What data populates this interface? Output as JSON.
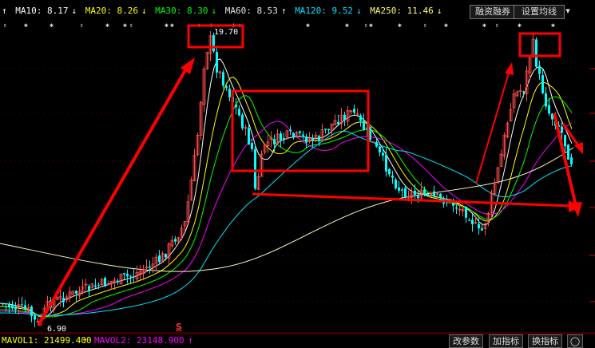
{
  "ma_legend": [
    {
      "label": "MA10: 8.17",
      "arrow": "↓",
      "color": "#ffffff",
      "arrow_color": "#ffffff"
    },
    {
      "label": "MA20: 8.26",
      "arrow": "↓",
      "color": "#ffff00",
      "arrow_color": "#ffff00"
    },
    {
      "label": "MA30: 8.30",
      "arrow": "↓",
      "color": "#00ff00",
      "arrow_color": "#00ff00"
    },
    {
      "label": "MA60: 8.53",
      "arrow": "↑",
      "color": "#e6e6e6",
      "arrow_color": "#e6e6e6"
    },
    {
      "label": "MA120: 9.52",
      "arrow": "↓",
      "color": "#00e5ff",
      "arrow_color": "#00e5ff"
    },
    {
      "label": "MA250: 11.46",
      "arrow": "↓",
      "color": "#ffff66",
      "arrow_color": "#ffff66"
    }
  ],
  "ma_prefix_arrow": "↑",
  "buttons": {
    "margin_trading": "融资融券",
    "set_ma": "设置均线",
    "dropdown": "▾"
  },
  "price_labels": {
    "high": "19.70",
    "low": "6.90"
  },
  "signal_marker": "S",
  "volume_bar": {
    "mavol1_label": "MAVOL1: 21499.400",
    "mavol1_arrow": "↑",
    "mavol2_label": "MAVOL2: 23148.900",
    "mavol2_arrow": "↑",
    "mavol1_color": "#ffff00",
    "mavol2_color": "#ff00ff"
  },
  "bottom_buttons": {
    "change_params": "改参数",
    "add_indicator": "加指标",
    "switch_indicator": "换指标",
    "icon": "options-icon"
  },
  "colors": {
    "up_candle": "#ff4d4d",
    "down_candle": "#00ffff",
    "annotation_red": "#ff0000"
  }
}
